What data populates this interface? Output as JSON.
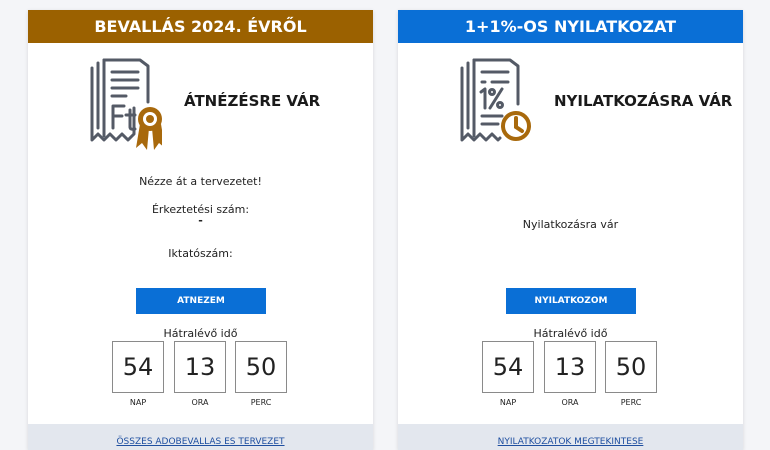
{
  "colors": {
    "tax_header": "#9b6100",
    "declaration_header": "#0a6fd6",
    "button": "#0a6fd6",
    "icon_stroke": "#545a66",
    "medal": "#a8690c",
    "clock": "#a8690c"
  },
  "tax_card": {
    "header": "BEVALLÁS 2024. ÉVRŐL",
    "illustration_icon": "tax-document-forint-medal-icon",
    "status": "ÁTNÉZÉSRE VÁR",
    "message": "Nézze át a tervezetet!",
    "arrival_number_label": "Érkeztetési szám:",
    "arrival_number_value": "-",
    "filing_number_label": "Iktatószám:",
    "button_label": "ATNEZEM",
    "countdown_label": "Hátralévő idő",
    "countdown": {
      "days": "54",
      "hours": "13",
      "minutes": "50",
      "days_label": "NAP",
      "hours_label": "ORA",
      "minutes_label": "PERC"
    },
    "footer_link": "ÖSSZES ADOBEVALLAS ES TERVEZET"
  },
  "declaration_card": {
    "header": "1+1%-OS NYILATKOZAT",
    "illustration_icon": "percent-document-clock-icon",
    "status": "NYILATKOZÁSRA VÁR",
    "message": "Nyilatkozásra vár",
    "button_label": "NYILATKOZOM",
    "countdown_label": "Hátralévő idő",
    "countdown": {
      "days": "54",
      "hours": "13",
      "minutes": "50",
      "days_label": "NAP",
      "hours_label": "ORA",
      "minutes_label": "PERC"
    },
    "footer_link": "NYILATKOZATOK MEGTEKINTESE"
  }
}
